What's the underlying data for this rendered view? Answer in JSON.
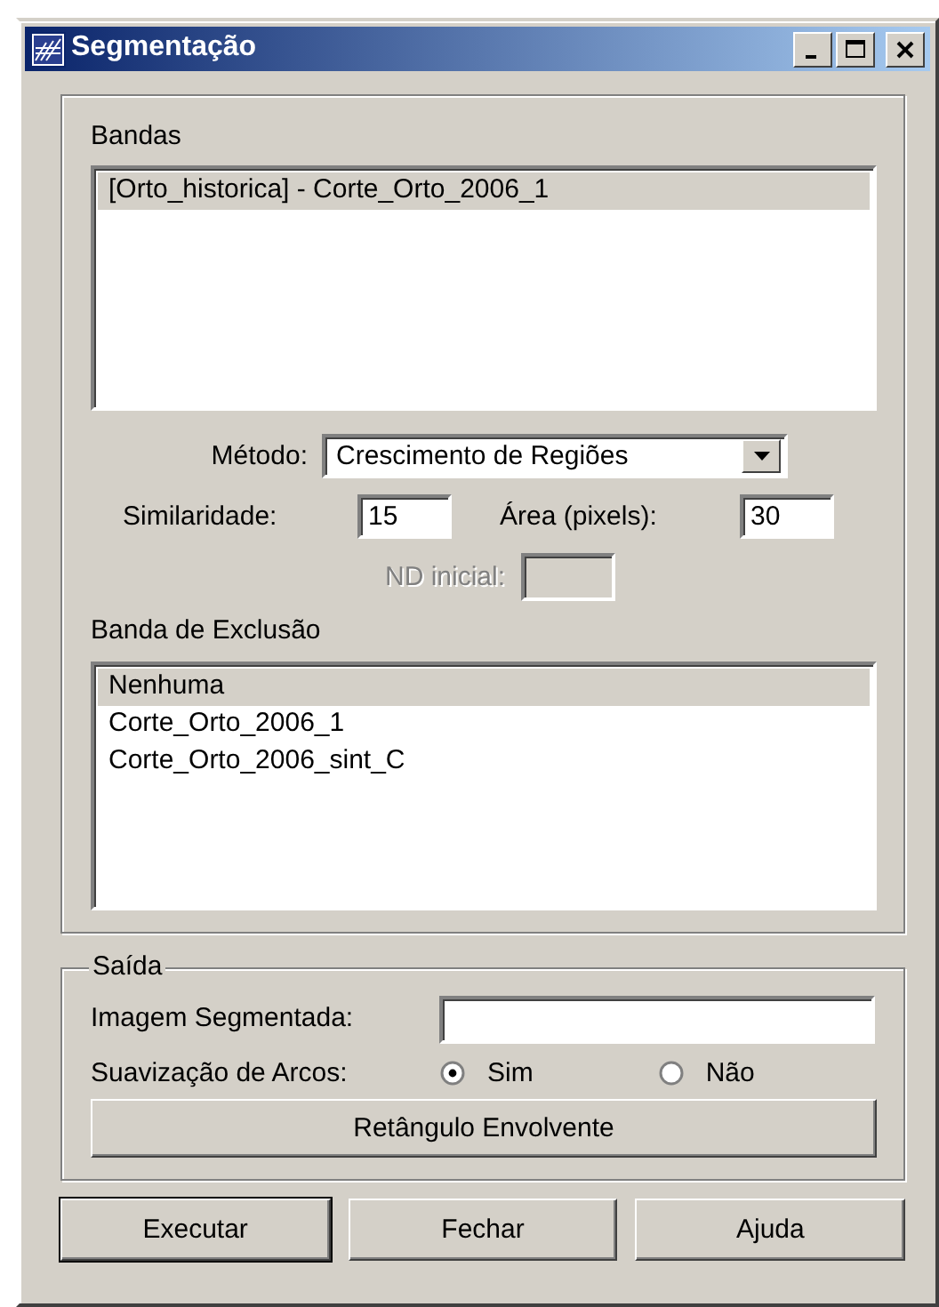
{
  "window": {
    "title": "Segmentação"
  },
  "bands": {
    "label": "Bandas",
    "items": [
      {
        "text": "[Orto_historica] - Corte_Orto_2006_1",
        "selected": true
      }
    ]
  },
  "method": {
    "label": "Método:",
    "value": "Crescimento de Regiões"
  },
  "similarity": {
    "label": "Similaridade:",
    "value": "15"
  },
  "area": {
    "label": "Área (pixels):",
    "value": "30"
  },
  "nd_initial": {
    "label": "ND inicial:",
    "disabled": true
  },
  "exclusion": {
    "label": "Banda de Exclusão",
    "items": [
      {
        "text": "Nenhuma",
        "selected": true
      },
      {
        "text": "Corte_Orto_2006_1",
        "selected": false
      },
      {
        "text": "Corte_Orto_2006_sint_C",
        "selected": false
      }
    ]
  },
  "output": {
    "legend": "Saída",
    "image_label": "Imagem Segmentada:",
    "smoothing_label": "Suavização de Arcos:",
    "smoothing_options": [
      {
        "label": "Sim",
        "selected": true
      },
      {
        "label": "Não",
        "selected": false
      }
    ],
    "bbox_button": "Retângulo Envolvente"
  },
  "buttons": [
    {
      "label": "Executar",
      "default": true
    },
    {
      "label": "Fechar",
      "default": false
    },
    {
      "label": "Ajuda",
      "default": false
    }
  ]
}
